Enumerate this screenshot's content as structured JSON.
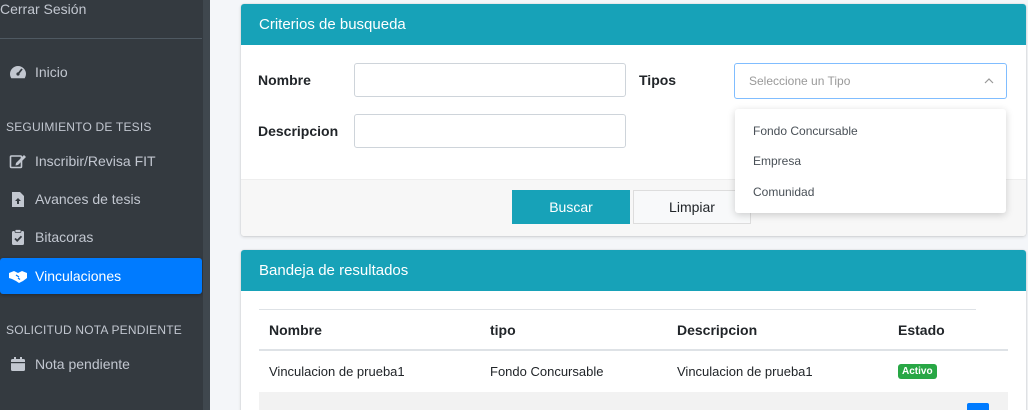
{
  "sidebar": {
    "logout_label": "Cerrar Sesión",
    "inicio_label": "Inicio",
    "section1_header": "SEGUIMIENTO DE TESIS",
    "items": [
      {
        "label": "Inscribir/Revisa FIT",
        "icon": "edit-icon"
      },
      {
        "label": "Avances de tesis",
        "icon": "file-upload-icon"
      },
      {
        "label": "Bitacoras",
        "icon": "clipboard-check-icon"
      },
      {
        "label": "Vinculaciones",
        "icon": "handshake-icon"
      }
    ],
    "section2_header": "SOLICITUD NOTA PENDIENTE",
    "nota_label": "Nota pendiente",
    "active_color": "#007bff"
  },
  "search_card": {
    "title": "Criterios de busqueda",
    "nombre_label": "Nombre",
    "nombre_value": "",
    "descripcion_label": "Descripcion",
    "descripcion_value": "",
    "tipos_label": "Tipos",
    "tipos_placeholder": "Seleccione un Tipo",
    "tipos_options": [
      "Fondo Concursable",
      "Empresa",
      "Comunidad"
    ],
    "buscar_label": "Buscar",
    "limpiar_label": "Limpiar",
    "header_color": "#17a2b8"
  },
  "results_card": {
    "title": "Bandeja de resultados",
    "columns": [
      "Nombre",
      "tipo",
      "Descripcion",
      "Estado"
    ],
    "rows": [
      {
        "nombre": "Vinculacion de prueba1",
        "tipo": "Fondo Concursable",
        "descripcion": "Vinculacion de prueba1",
        "estado": "Activo"
      }
    ],
    "badge_color": "#28a745"
  }
}
